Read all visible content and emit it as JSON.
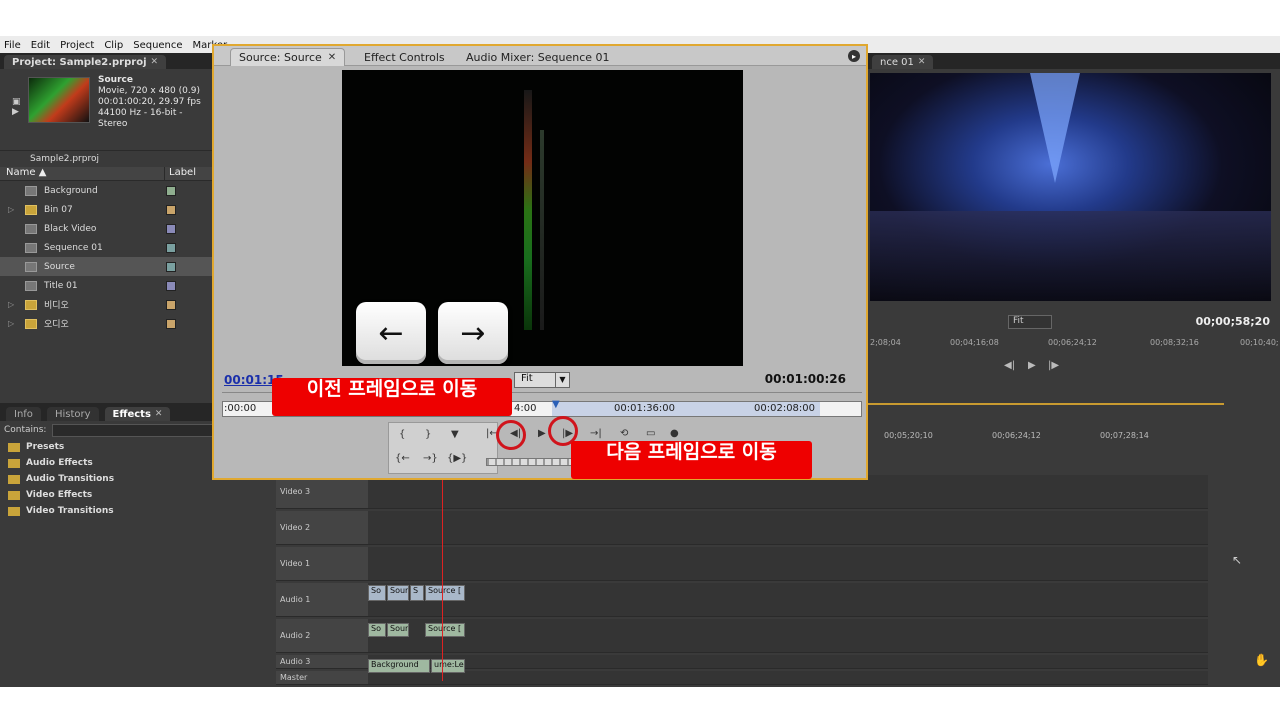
{
  "menu": [
    "File",
    "Edit",
    "Project",
    "Clip",
    "Sequence",
    "Marker"
  ],
  "project": {
    "tab": "Project: Sample2.prproj",
    "clip_name": "Source",
    "clip_line1": "Movie, 720 x 480 (0.9)",
    "clip_line2": "00:01:00:20, 29.97 fps",
    "clip_line3": "44100 Hz - 16-bit - Stereo",
    "file": "Sample2.prproj",
    "col_name": "Name",
    "col_label": "Label",
    "items": [
      {
        "name": "Background",
        "type": "audio",
        "label_color": "#8fae8f"
      },
      {
        "name": "Bin 07",
        "type": "folder",
        "label_color": "#c9a46a"
      },
      {
        "name": "Black Video",
        "type": "video",
        "label_color": "#8a8ab8"
      },
      {
        "name": "Sequence 01",
        "type": "sequence",
        "label_color": "#7aa0a0"
      },
      {
        "name": "Source",
        "type": "clip",
        "label_color": "#7aa0a0"
      },
      {
        "name": "Title 01",
        "type": "title",
        "label_color": "#8a8ab8"
      },
      {
        "name": "비디오",
        "type": "folder",
        "label_color": "#c9a46a"
      },
      {
        "name": "오디오",
        "type": "folder",
        "label_color": "#c9a46a"
      }
    ]
  },
  "effects": {
    "tabs": [
      "Info",
      "History",
      "Effects"
    ],
    "contains_label": "Contains:",
    "items": [
      "Presets",
      "Audio Effects",
      "Audio Transitions",
      "Video Effects",
      "Video Transitions"
    ]
  },
  "source": {
    "tabs": [
      "Source: Source",
      "Effect Controls",
      "Audio Mixer: Sequence 01"
    ],
    "timecode_left": "00:01:15",
    "fit": "Fit",
    "timecode_right": "00:01:00:26",
    "ruler": [
      ":00:00",
      "4:00",
      "00:01:36:00",
      "00:02:08:00"
    ],
    "key_left": "←",
    "key_right": "→"
  },
  "callouts": {
    "prev": "이전 프레임으로 이동",
    "next": "다음 프레임으로 이동"
  },
  "program": {
    "tab": "nce 01",
    "fit": "Fit",
    "timecode": "00;00;58;20",
    "ruler": [
      "2;08;04",
      "00;04;16;08",
      "00;06;24;12",
      "00;08;32;16",
      "00;10;40;"
    ]
  },
  "timeline": {
    "ruler": [
      "00;05;20;10",
      "00;06;24;12",
      "00;07;28;14"
    ],
    "tracks": [
      "Video 3",
      "Video 2",
      "Video 1",
      "Audio 1",
      "Audio 2",
      "Audio 3",
      "Master"
    ],
    "clip_labels": [
      "So",
      "Sour",
      "S",
      "Source [",
      "Background",
      "ume:Level"
    ]
  }
}
